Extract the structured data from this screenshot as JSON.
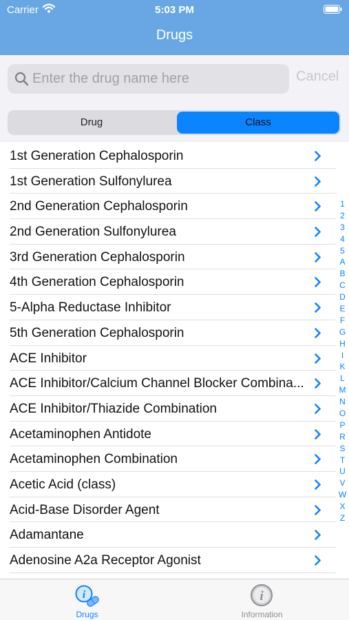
{
  "status_bar": {
    "carrier": "Carrier",
    "time": "5:03 PM",
    "wifi_icon": "wifi-icon",
    "battery_icon": "battery-icon"
  },
  "nav": {
    "title": "Drugs"
  },
  "search": {
    "placeholder": "Enter the drug name here",
    "value": "",
    "cancel_label": "Cancel",
    "icon": "search-icon"
  },
  "segments": {
    "drug_label": "Drug",
    "class_label": "Class",
    "selected": "Class"
  },
  "list": {
    "items": [
      "1st Generation Cephalosporin",
      "1st Generation Sulfonylurea",
      "2nd Generation Cephalosporin",
      "2nd Generation Sulfonylurea",
      "3rd Generation Cephalosporin",
      "4th Generation Cephalosporin",
      "5-Alpha Reductase Inhibitor",
      "5th Generation Cephalosporin",
      "ACE Inhibitor",
      "ACE Inhibitor/Calcium Channel Blocker Combina...",
      "ACE Inhibitor/Thiazide Combination",
      "Acetaminophen Antidote",
      "Acetaminophen Combination",
      "Acetic Acid (class)",
      "Acid-Base Disorder Agent",
      "Adamantane",
      "Adenosine A2a Receptor Agonist"
    ],
    "row_icon": "chevron-right-icon"
  },
  "section_index": [
    "1",
    "2",
    "3",
    "4",
    "5",
    "A",
    "B",
    "C",
    "D",
    "E",
    "F",
    "G",
    "H",
    "I",
    "K",
    "L",
    "M",
    "N",
    "O",
    "P",
    "R",
    "S",
    "T",
    "U",
    "V",
    "W",
    "X",
    "Z"
  ],
  "tab_bar": {
    "tabs": [
      {
        "label": "Drugs",
        "icon": "drugs-info-pill-icon",
        "selected": true
      },
      {
        "label": "Information",
        "icon": "info-circle-icon",
        "selected": false
      }
    ]
  },
  "colors": {
    "nav_background": "#68a7e3",
    "accent": "#0a84ff",
    "search_background": "#f2f2f7"
  }
}
